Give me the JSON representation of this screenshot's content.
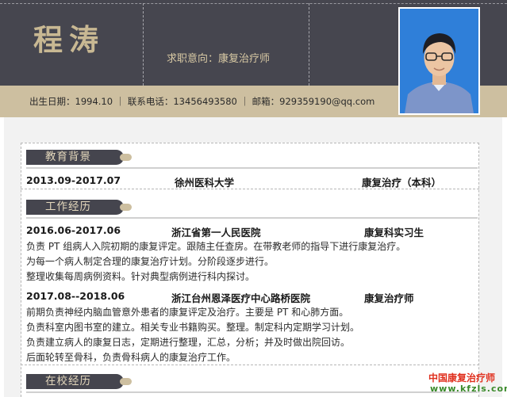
{
  "header": {
    "name": "程涛",
    "job_intent": "求职意向：康复治疗师",
    "contact_line": "出生日期：1994.10  ｜ 联系电话：13456493580  ｜ 邮箱：929359190@qq.com"
  },
  "education": {
    "title": "教育背景",
    "period": "2013.09-2017.07",
    "school": "徐州医科大学",
    "major": "康复治疗（本科）"
  },
  "work": {
    "title": "工作经历",
    "jobs": [
      {
        "period": "2016.06-2017.06",
        "org": "浙江省第一人民医院",
        "role": "康复科实习生",
        "lines": [
          "负责 PT 组病人入院初期的康复评定。跟随主任查房。在带教老师的指导下进行康复治疗。",
          "为每一个病人制定合理的康复治疗计划。分阶段逐步进行。",
          "整理收集每周病例资料。针对典型病例进行科内探讨。"
        ]
      },
      {
        "period": "2017.08--2018.06",
        "org": "浙江台州恩泽医疗中心路桥医院",
        "role": "康复治疗师",
        "lines": [
          "前期负责神经内脑血管意外患者的康复评定及治疗。主要是 PT 和心肺方面。",
          "负责科室内图书室的建立。相关专业书籍购买。整理。制定科内定期学习计划。",
          "负责建立病人的康复日志，定期进行整理，汇总，分析；并及时做出院回访。",
          "后面轮转至骨科，负责骨科病人的康复治疗工作。"
        ]
      }
    ]
  },
  "campus": {
    "title": "在校经历"
  },
  "watermark": {
    "line1": "中国康复治疗师",
    "line2": "www.kfzls.com"
  },
  "colors": {
    "header_dark": "#46464f",
    "accent_tan": "#cdbfa0",
    "name_gold": "#c8b893"
  }
}
